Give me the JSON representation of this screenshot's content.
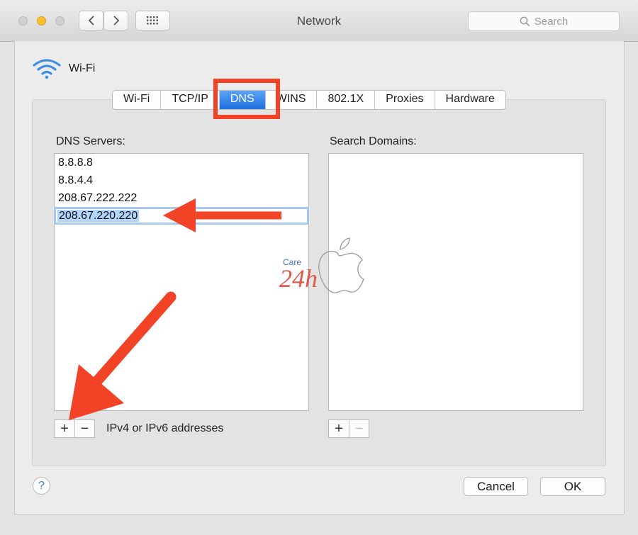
{
  "window": {
    "title": "Network",
    "search_placeholder": "Search"
  },
  "interface": {
    "name": "Wi-Fi",
    "icon": "wifi-icon"
  },
  "tabs": [
    {
      "label": "Wi-Fi",
      "active": false
    },
    {
      "label": "TCP/IP",
      "active": false
    },
    {
      "label": "DNS",
      "active": true
    },
    {
      "label": "WINS",
      "active": false
    },
    {
      "label": "802.1X",
      "active": false
    },
    {
      "label": "Proxies",
      "active": false
    },
    {
      "label": "Hardware",
      "active": false
    }
  ],
  "dns": {
    "label": "DNS Servers:",
    "servers": [
      "8.8.8.8",
      "8.8.4.4",
      "208.67.222.222",
      "208.67.220.220"
    ],
    "add_label": "+",
    "remove_label": "−",
    "hint": "IPv4 or IPv6 addresses"
  },
  "search_domains": {
    "label": "Search Domains:",
    "add_label": "+",
    "remove_label": "−"
  },
  "buttons": {
    "help": "?",
    "cancel": "Cancel",
    "ok": "OK"
  },
  "watermark": {
    "top": "Care",
    "bottom": "24h"
  },
  "colors": {
    "accent": "#1d6fe0",
    "annotation": "#f24327"
  }
}
